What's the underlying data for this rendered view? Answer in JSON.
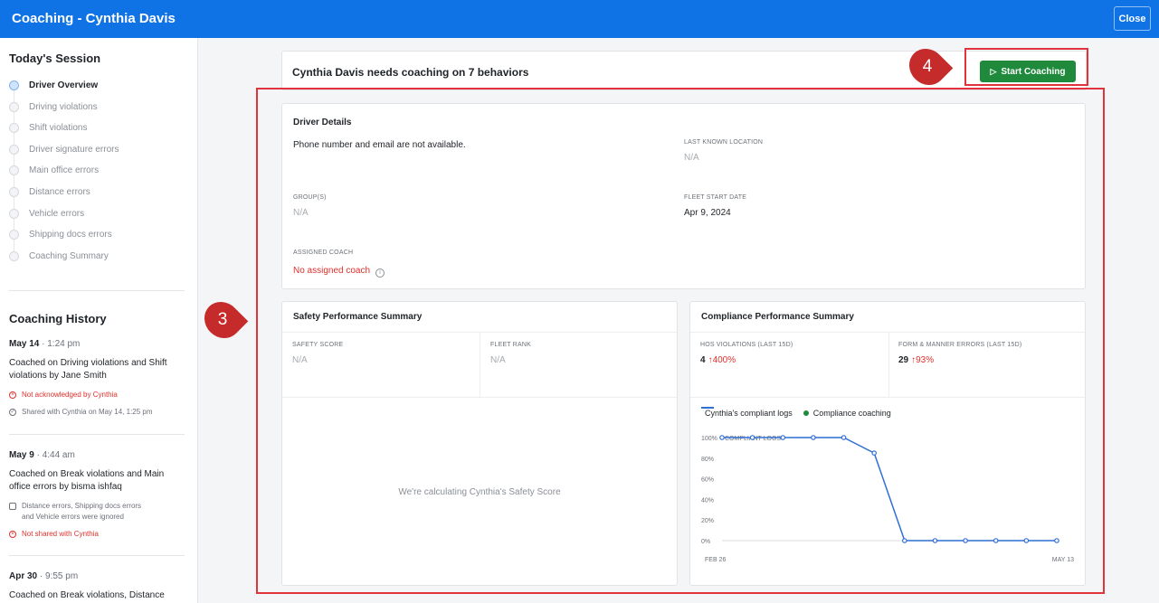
{
  "app": {
    "title": "Coaching - Cynthia Davis",
    "close_label": "Close"
  },
  "sidebar": {
    "session_heading": "Today's Session",
    "steps": [
      {
        "label": "Driver Overview",
        "active": true
      },
      {
        "label": "Driving violations"
      },
      {
        "label": "Shift violations"
      },
      {
        "label": "Driver signature errors"
      },
      {
        "label": "Main office errors"
      },
      {
        "label": "Distance errors"
      },
      {
        "label": "Vehicle errors"
      },
      {
        "label": "Shipping docs errors"
      },
      {
        "label": "Coaching Summary"
      }
    ],
    "history_heading": "Coaching History",
    "history": [
      {
        "date": "May 14",
        "time": "1:24 pm",
        "description": "Coached on Driving violations and Shift violations by Jane Smith",
        "meta": [
          {
            "text": "Not acknowledged by Cynthia",
            "status": "error"
          },
          {
            "text": "Shared with Cynthia on May 14, 1:25 pm",
            "status": "ok"
          }
        ]
      },
      {
        "date": "May 9",
        "time": "4:44 am",
        "description": "Coached on Break violations and Main office errors by bisma ishfaq",
        "meta": [
          {
            "text": "Distance errors, Shipping docs errors and Vehicle errors were ignored",
            "status": "neutral"
          },
          {
            "text": "Not shared with Cynthia",
            "status": "error"
          }
        ]
      },
      {
        "date": "Apr 30",
        "time": "9:55 pm",
        "description": "Coached on Break violations, Distance",
        "meta": []
      }
    ]
  },
  "main": {
    "header_title": "Cynthia Davis needs coaching on 7 behaviors",
    "start_coaching_label": "Start Coaching",
    "annotations": {
      "marker_3": "3",
      "marker_4": "4"
    },
    "driver_details": {
      "title": "Driver Details",
      "contact_note": "Phone number and email are not available.",
      "last_known_location_label": "LAST KNOWN LOCATION",
      "last_known_location_value": "N/A",
      "groups_label": "GROUP(S)",
      "groups_value": "N/A",
      "fleet_start_date_label": "FLEET START DATE",
      "fleet_start_date_value": "Apr 9, 2024",
      "assigned_coach_label": "ASSIGNED COACH",
      "assigned_coach_value": "No assigned coach"
    },
    "safety": {
      "title": "Safety Performance Summary",
      "safety_score_label": "SAFETY SCORE",
      "safety_score_value": "N/A",
      "fleet_rank_label": "FLEET RANK",
      "fleet_rank_value": "N/A",
      "calculating_message": "We're calculating Cynthia's Safety Score"
    },
    "compliance": {
      "title": "Compliance Performance Summary",
      "hos_label": "HOS VIOLATIONS (LAST 15D)",
      "hos_value": "4",
      "hos_change": "400%",
      "form_label": "FORM & MANNER ERRORS (LAST 15D)",
      "form_value": "29",
      "form_change": "93%",
      "legend_line": "Cynthia's compliant logs",
      "legend_dot": "Compliance coaching"
    }
  },
  "colors": {
    "brand": "#0f73e6",
    "success": "#1f8a3b",
    "error": "#e0302b",
    "series": "#2f6fd6",
    "annotation": "#e0333c"
  },
  "chart_data": {
    "type": "line",
    "ylabel": "COMPLIANT LOGS",
    "ylim": [
      0,
      100
    ],
    "y_ticks": [
      "0%",
      "20%",
      "40%",
      "60%",
      "80%",
      "100%"
    ],
    "x_tick_labels": [
      "FEB 26",
      "MAY 13"
    ],
    "series": [
      {
        "name": "Cynthia's compliant logs",
        "values": [
          100,
          100,
          100,
          100,
          100,
          85,
          0,
          0,
          0,
          0,
          0,
          0
        ]
      }
    ],
    "legend_position": "top-left"
  }
}
